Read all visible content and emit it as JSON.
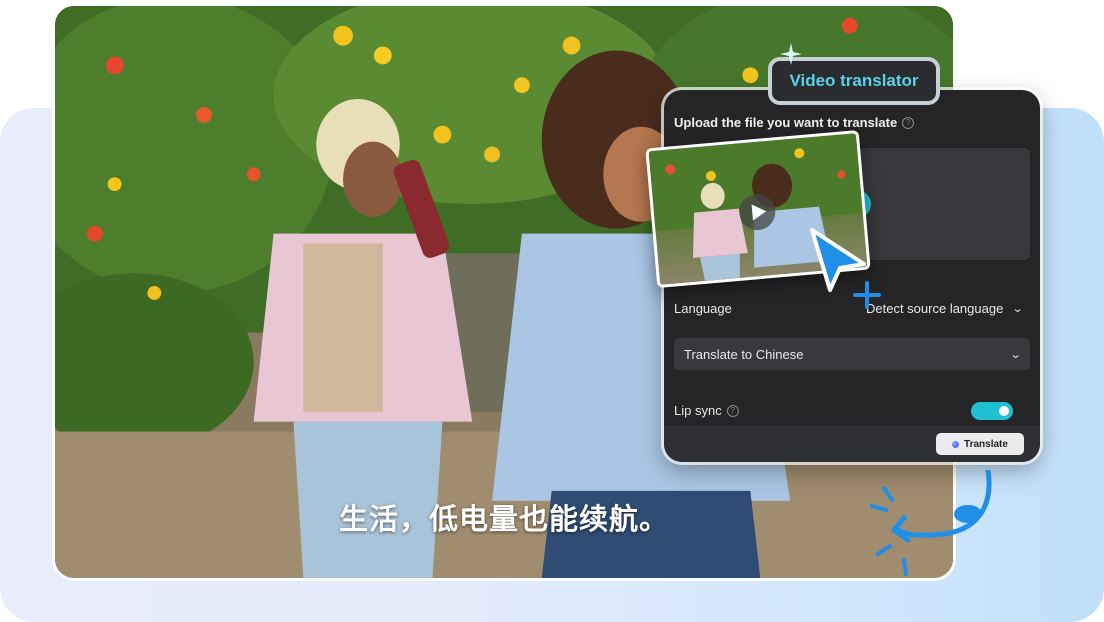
{
  "subtitle": "生活，低电量也能续航。",
  "badge": {
    "label": "Video translator"
  },
  "panel": {
    "upload_label": "Upload the file you want to translate",
    "language_label": "Language",
    "source_language": "Detect source language",
    "target_language": "Translate to Chinese",
    "lip_sync_label": "Lip sync",
    "lip_sync_on": true,
    "translate_button": "Translate",
    "help_glyph": "?"
  },
  "colors": {
    "accent": "#22c0d4",
    "panel_bg": "#252527",
    "field_bg": "#38393c",
    "badge_text": "#58d2e6"
  },
  "icons": {
    "add": "plus-icon",
    "play": "play-icon",
    "cursor": "pointer-cursor-icon",
    "chevron": "chevron-down-icon",
    "help": "help-circle-icon"
  }
}
